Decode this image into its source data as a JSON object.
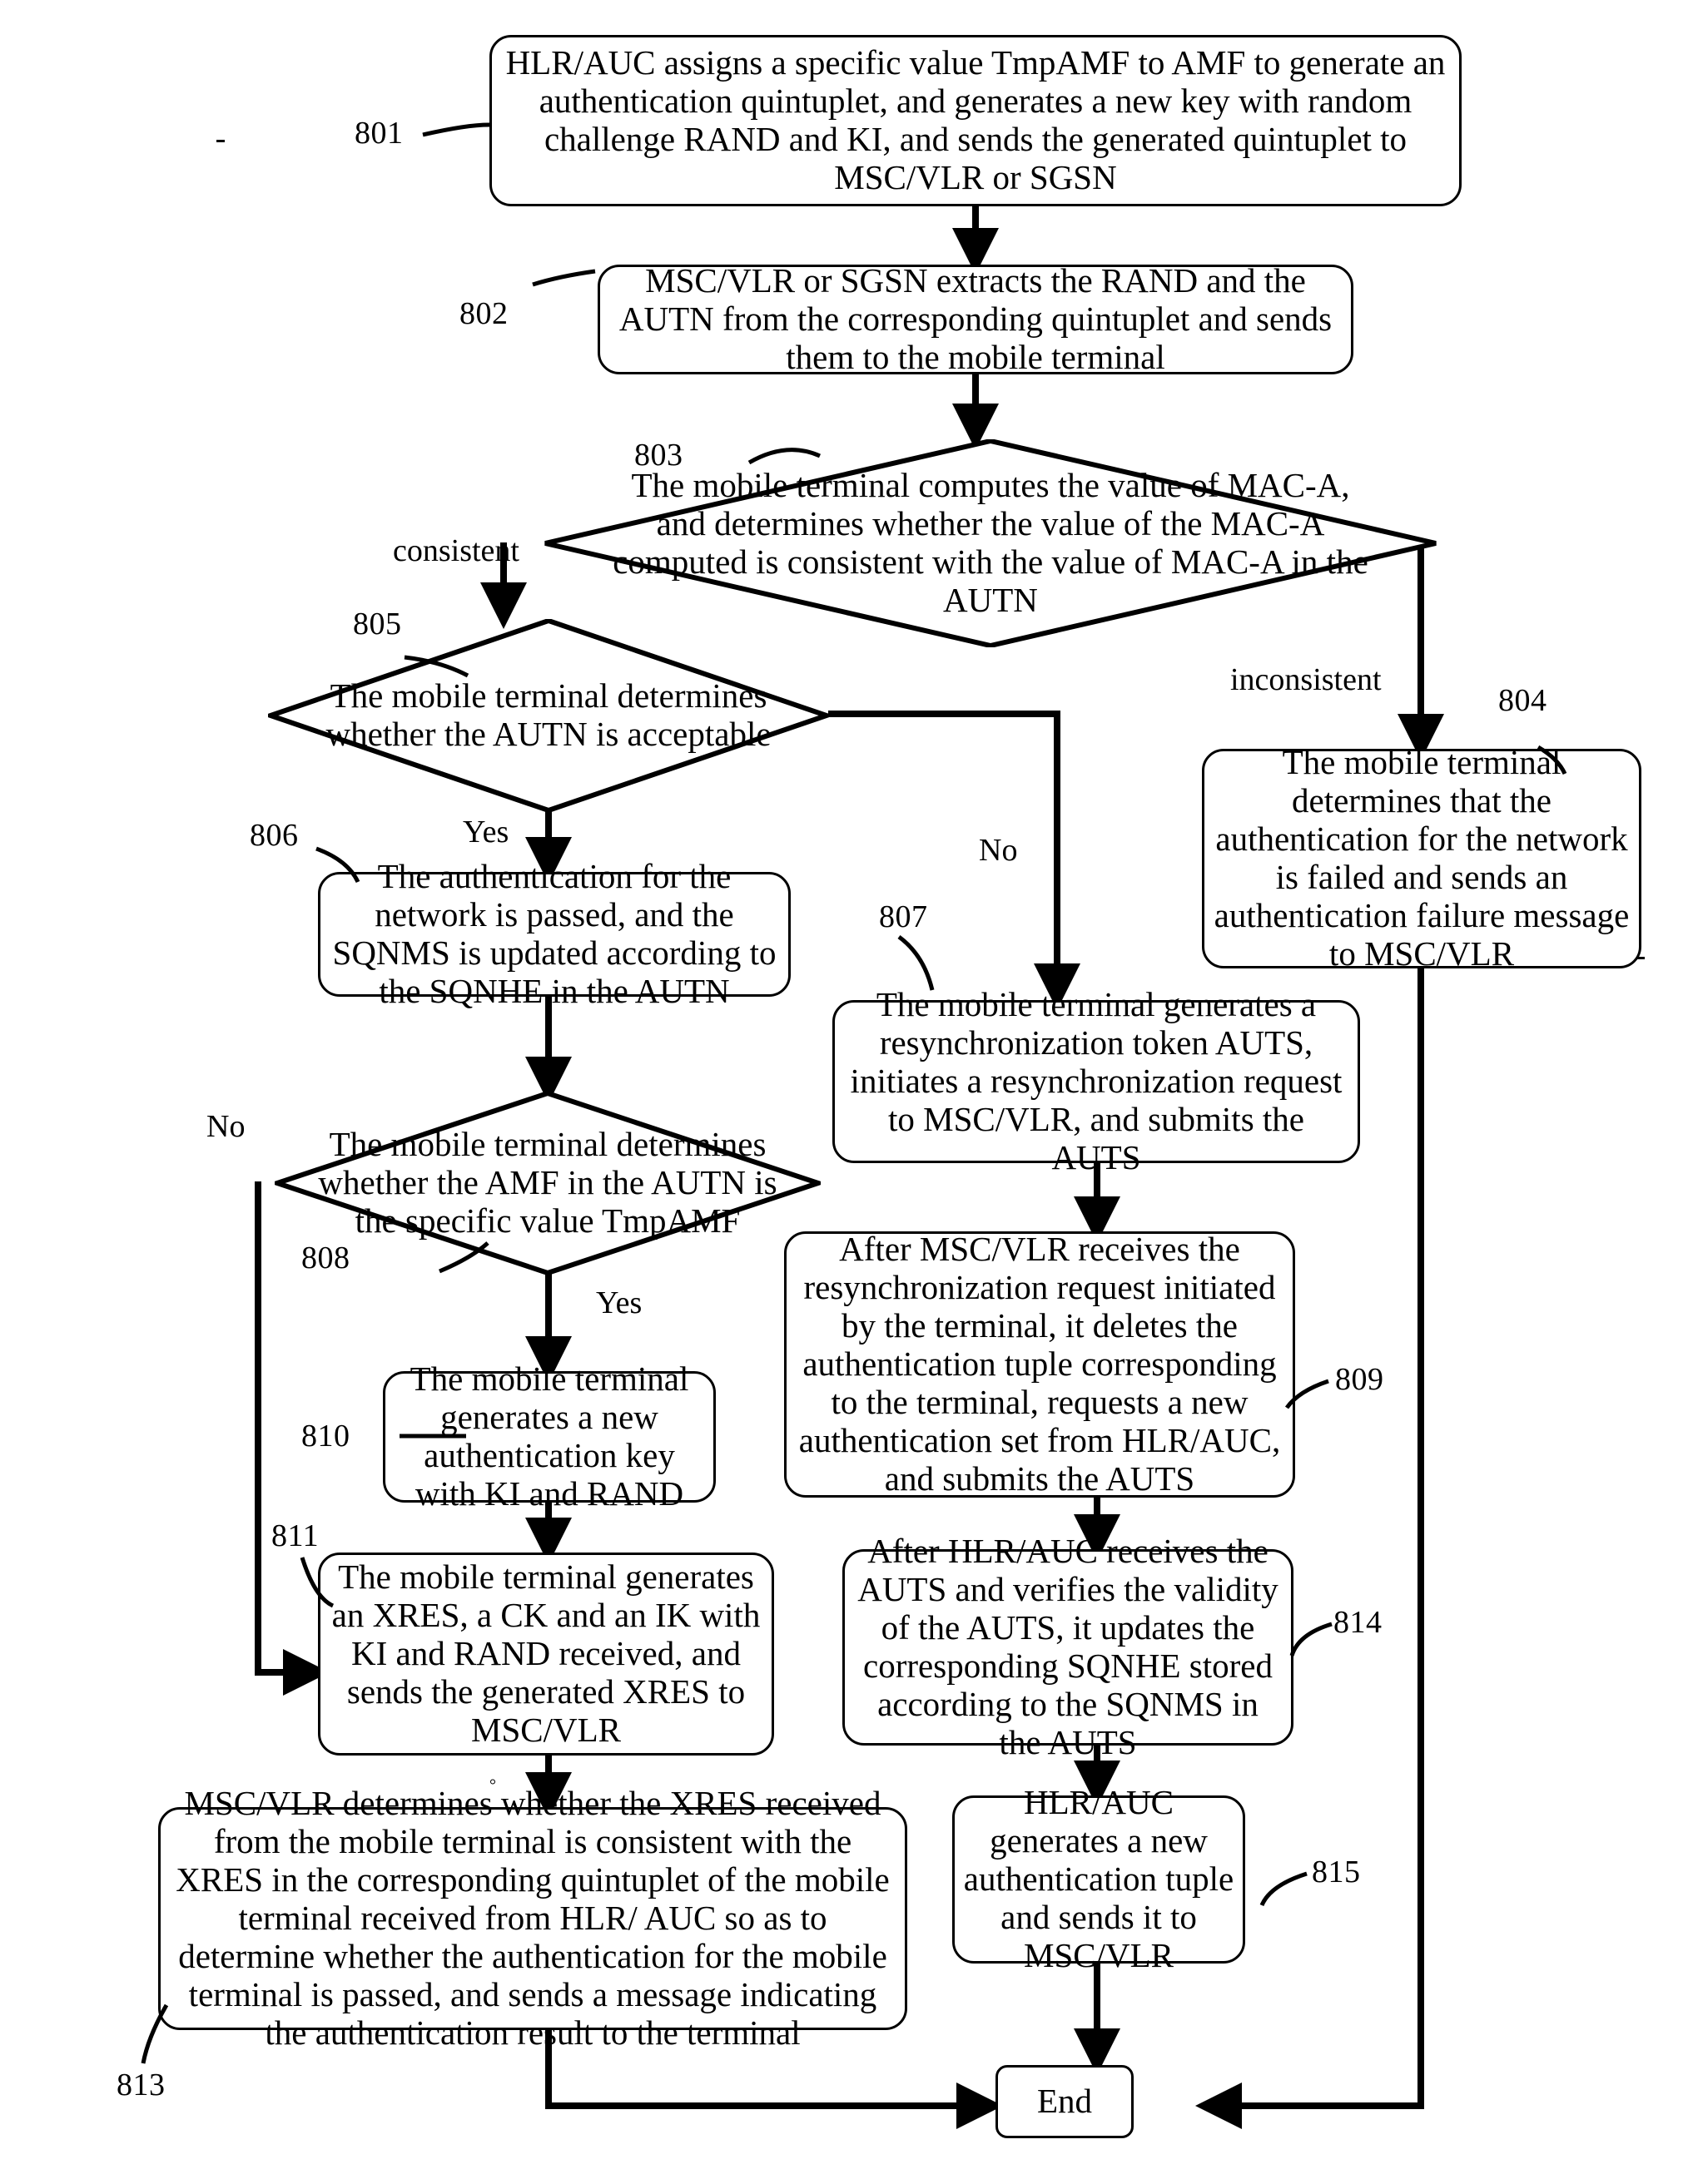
{
  "diagram": {
    "title": "Authentication flow with TmpAMF (Fig. 8)",
    "type": "flowchart",
    "nodes": [
      {
        "id": "801",
        "ref": "801",
        "shape": "process",
        "text": "HLR/AUC assigns a specific value TmpAMF to AMF to generate an authentication quintuplet, and generates a new key with random challenge RAND and KI, and sends the generated quintuplet to MSC/VLR or SGSN"
      },
      {
        "id": "802",
        "ref": "802",
        "shape": "process",
        "text": "MSC/VLR or SGSN extracts the RAND and the AUTN from the corresponding quintuplet and sends them to the mobile terminal"
      },
      {
        "id": "803",
        "ref": "803",
        "shape": "decision",
        "text": "The mobile terminal computes the value of MAC-A, and determines whether the value of the MAC-A computed is consistent with the value of MAC-A in the AUTN"
      },
      {
        "id": "804",
        "ref": "804",
        "shape": "process",
        "text": "The mobile terminal determines that the authentication for the network is failed and sends an authentication failure message to MSC/VLR"
      },
      {
        "id": "805",
        "ref": "805",
        "shape": "decision",
        "text": "The mobile terminal determines whether the AUTN is acceptable"
      },
      {
        "id": "806",
        "ref": "806",
        "shape": "process",
        "text": "The authentication for the network is passed, and the SQNMS is updated according to the SQNHE in the AUTN"
      },
      {
        "id": "807",
        "ref": "807",
        "shape": "process",
        "text": "The mobile terminal generates a resynchronization token AUTS, initiates a resynchronization request to MSC/VLR, and submits the AUTS"
      },
      {
        "id": "808",
        "ref": "808",
        "shape": "decision",
        "text": "The mobile terminal determines whether the AMF in the AUTN is the specific value TmpAMF"
      },
      {
        "id": "809",
        "ref": "809",
        "shape": "process",
        "text": "After MSC/VLR receives the resynchronization request initiated by the terminal, it deletes the authentication tuple corresponding to the terminal, requests a new authentication set from HLR/AUC, and submits the AUTS"
      },
      {
        "id": "810",
        "ref": "810",
        "shape": "process",
        "text": "The mobile terminal generates a new authentication key with KI and RAND"
      },
      {
        "id": "811",
        "ref": "811",
        "shape": "process",
        "text": "The mobile terminal generates an XRES, a CK and an IK with KI and RAND received, and sends the generated XRES to MSC/VLR"
      },
      {
        "id": "813",
        "ref": "813",
        "shape": "process",
        "text": "MSC/VLR determines whether the XRES received from the mobile terminal is consistent with the XRES in the corresponding quintuplet of the mobile terminal received from HLR/ AUC so as to determine whether the authentication for the mobile terminal is passed, and sends a message indicating the authentication result to the terminal"
      },
      {
        "id": "814",
        "ref": "814",
        "shape": "process",
        "text": "After HLR/AUC receives the AUTS and verifies the validity of the AUTS, it updates the corresponding SQNHE stored according to the SQNMS in the AUTS"
      },
      {
        "id": "815",
        "ref": "815",
        "shape": "process",
        "text": "HLR/AUC generates a new authentication tuple and sends it to MSC/VLR"
      },
      {
        "id": "end",
        "ref": "",
        "shape": "terminator",
        "text": "End"
      }
    ],
    "edge_labels": {
      "consistent": "consistent",
      "inconsistent": "inconsistent",
      "yes_805": "Yes",
      "no_805": "No",
      "yes_808": "Yes",
      "no_808": "No"
    },
    "colors": {
      "stroke": "#000000",
      "fill": "#ffffff",
      "text": "#000000"
    }
  }
}
